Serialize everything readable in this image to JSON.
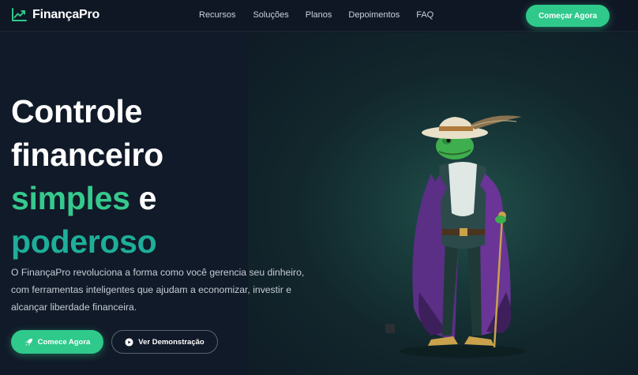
{
  "navbar": {
    "logo_icon": "chart-line-icon",
    "logo_text": "FinançaPro",
    "links": [
      "Recursos",
      "Soluções",
      "Planos",
      "Depoimentos",
      "FAQ"
    ],
    "cta_label": "Começar Agora"
  },
  "hero": {
    "headline": {
      "line1": "Controle",
      "line2": "financeiro",
      "line3_green": "simples",
      "line3_rest": " e",
      "line4_teal": "poderoso"
    },
    "subtext": "O FinançaPro revoluciona a forma como você gerencia seu dinheiro, com ferramentas inteligentes que ajudam a economizar, investir e alcançar liberdade financeira.",
    "primary_button": {
      "icon": "rocket-icon",
      "label": "Comece Agora"
    },
    "secondary_button": {
      "icon": "play-circle-icon",
      "label": "Ver Demonstração"
    },
    "illustration": "frog-dandy-illustration"
  },
  "colors": {
    "accent_green": "#2fc98c",
    "headline_green": "#35c98d",
    "headline_teal": "#1eae9a",
    "background": "#111a28"
  }
}
